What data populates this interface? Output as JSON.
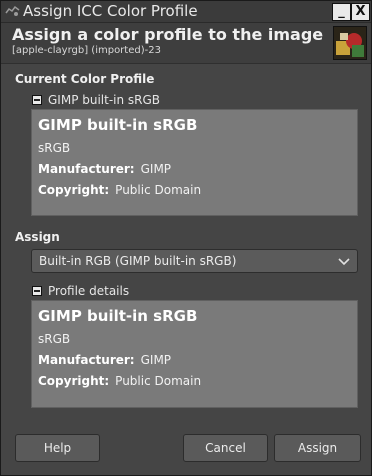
{
  "window": {
    "title": "Assign ICC Color Profile",
    "minimize_label": "_",
    "close_label": "X"
  },
  "header": {
    "title": "Assign a color profile to the image",
    "subtitle": "[apple-clayrgb] (imported)-23"
  },
  "current": {
    "section_label": "Current Color Profile",
    "expander_label": "GIMP built-in sRGB",
    "profile": {
      "name": "GIMP built-in sRGB",
      "description": "sRGB",
      "manufacturer_label": "Manufacturer:",
      "manufacturer": "GIMP",
      "copyright_label": "Copyright:",
      "copyright": "Public Domain"
    }
  },
  "assign": {
    "section_label": "Assign",
    "selected": "Built-in RGB (GIMP built-in sRGB)",
    "expander_label": "Profile details",
    "profile": {
      "name": "GIMP built-in sRGB",
      "description": "sRGB",
      "manufacturer_label": "Manufacturer:",
      "manufacturer": "GIMP",
      "copyright_label": "Copyright:",
      "copyright": "Public Domain"
    }
  },
  "buttons": {
    "help": "Help",
    "cancel": "Cancel",
    "assign": "Assign"
  },
  "colors": {
    "window_bg": "#454545",
    "profile_box_bg": "#7a7a7a",
    "button_bg": "#5a5a5a"
  }
}
